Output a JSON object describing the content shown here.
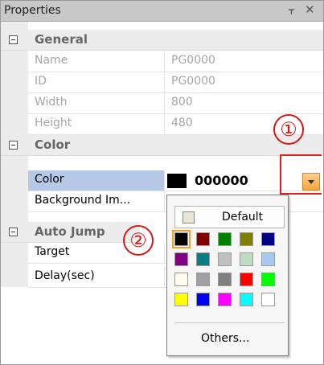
{
  "title": "Properties",
  "title_icons": {
    "pin": "pin-icon",
    "close": "close-icon"
  },
  "categories": [
    {
      "label": "General"
    },
    {
      "label": "Color"
    },
    {
      "label": "Auto Jump"
    }
  ],
  "general_rows": [
    {
      "name": "Name",
      "value": "PG0000"
    },
    {
      "name": "ID",
      "value": "PG0000"
    },
    {
      "name": "Width",
      "value": "800"
    },
    {
      "name": "Height",
      "value": "480"
    }
  ],
  "color_rows": [
    {
      "name": "Color",
      "value": "000000"
    },
    {
      "name": "Background Im..."
    }
  ],
  "autojump_rows": [
    {
      "name": "Target"
    },
    {
      "name": "Delay(sec)"
    }
  ],
  "callouts": {
    "one": "①",
    "two": "②"
  },
  "popup": {
    "default_label": "Default",
    "others_label": "Others...",
    "palette": [
      [
        "#000000",
        "#800000",
        "#008000",
        "#808000",
        "#000080"
      ],
      [
        "#800080",
        "#008080",
        "#c0c0c0",
        "#c0dcc0",
        "#a6caf0"
      ],
      [
        "#fffbf0",
        "#a0a0a4",
        "#808080",
        "#ff0000",
        "#00ff00"
      ],
      [
        "#ffff00",
        "#0000ff",
        "#ff00ff",
        "#00ffff",
        "#ffffff"
      ]
    ],
    "selected": "#000000"
  },
  "colors": {
    "accent": "#f6a440",
    "callout": "#d41919",
    "selection": "#b5c8e6"
  }
}
